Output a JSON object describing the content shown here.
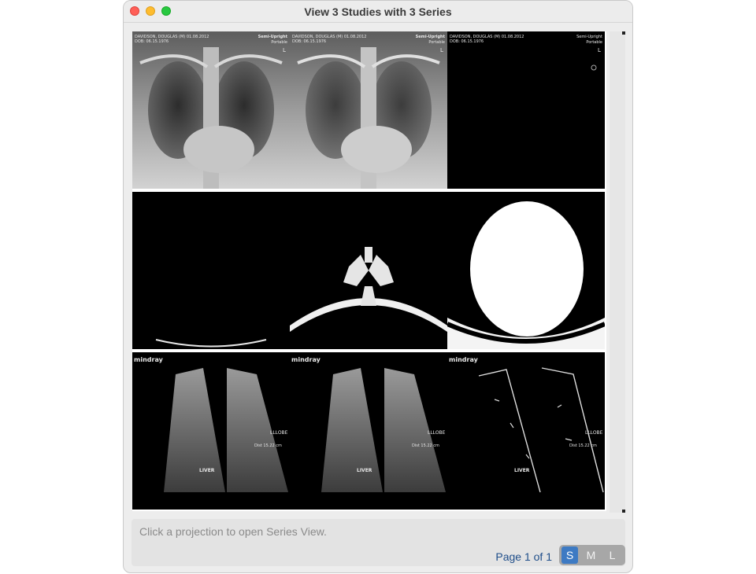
{
  "window": {
    "title": "View 3 Studies with 3 Series"
  },
  "studies": [
    {
      "id": "xray",
      "thumbnails": [
        {
          "overlay_left": "DAVIDSON, DOUGLAS (M) 01.08.2012",
          "overlay_left2": "DOB: 06.15.1976",
          "overlay_right": "Semi-Upright",
          "overlay_right2": "Portable",
          "marker": "L"
        },
        {
          "overlay_left": "DAVIDSON, DOUGLAS (M) 01.08.2012",
          "overlay_left2": "DOB: 06.15.1976",
          "overlay_right": "Semi-Upright",
          "overlay_right2": "Portable",
          "marker": "L"
        },
        {
          "overlay_left": "DAVIDSON, DOUGLAS (M) 01.08.2012",
          "overlay_left2": "DOB: 06.15.1976",
          "overlay_right": "Semi-Upright",
          "overlay_right2": "Portable",
          "marker": "L"
        }
      ]
    },
    {
      "id": "ct",
      "thumbnails": [
        {},
        {},
        {}
      ]
    },
    {
      "id": "ultrasound",
      "thumbnails": [
        {
          "brand": "mindray",
          "organ": "LIVER",
          "label2": "LLLOBE",
          "dist": "Dist 15.22 cm"
        },
        {
          "brand": "mindray",
          "organ": "LIVER",
          "label2": "LLLOBE",
          "dist": "Dist 15.22 cm"
        },
        {
          "brand": "mindray",
          "organ": "LIVER",
          "label2": "LLLOBE",
          "dist": "Dist 15.22 cm"
        }
      ]
    }
  ],
  "footer": {
    "hint": "Click a projection to open Series View.",
    "page_label": "Page 1 of 1",
    "sizes": [
      "S",
      "M",
      "L"
    ],
    "active_size": "S"
  },
  "colors": {
    "accent": "#3d7ac3",
    "close": "#ff5f57",
    "minimize": "#febc2e",
    "maximize": "#28c840"
  }
}
